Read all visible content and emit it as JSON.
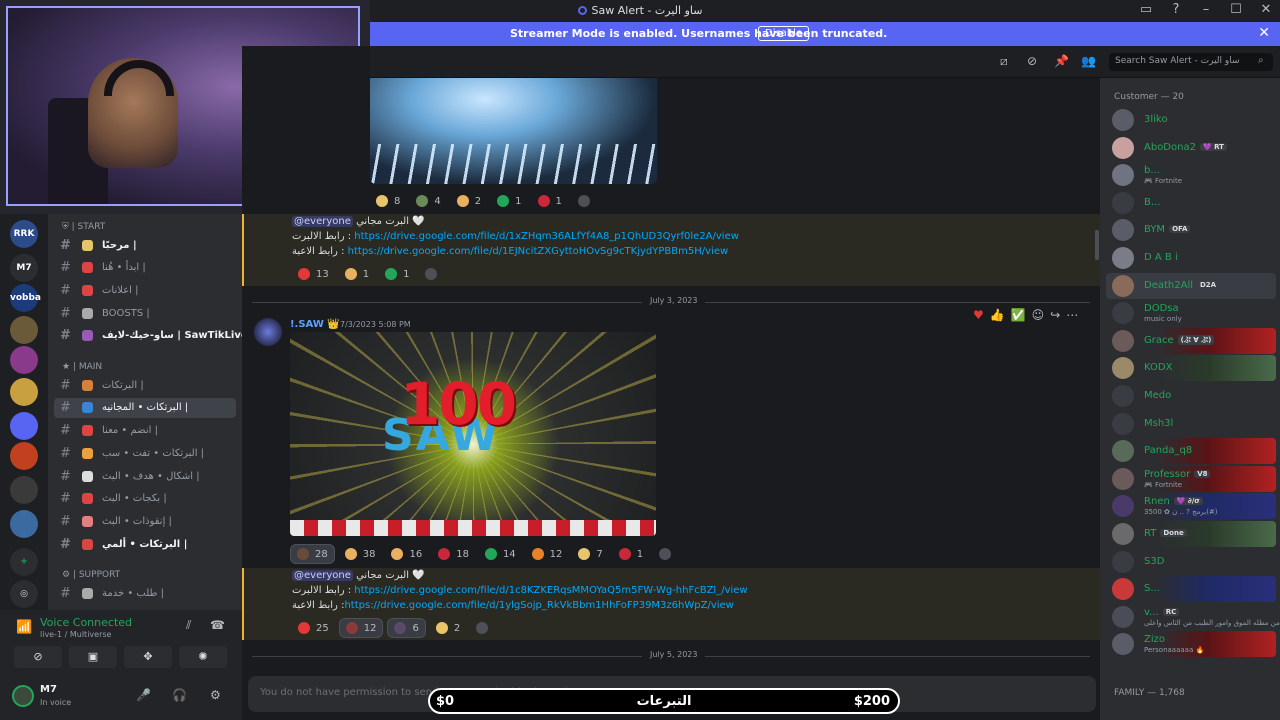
{
  "window": {
    "title": "Saw Alert - ساو اليرت",
    "controls": [
      "▭",
      "?",
      "–",
      "☐",
      "✕"
    ]
  },
  "banner": {
    "text": "Streamer Mode is enabled. Usernames have been truncated.",
    "button": "Disable",
    "close": "✕"
  },
  "servers": [
    {
      "label": "RRK",
      "color": "#2d4a8a"
    },
    {
      "label": "M7\nDN",
      "color": "#2b2d31"
    },
    {
      "label": "vobba",
      "color": "#1c3b7a"
    },
    {
      "label": "",
      "color": "#6a5a3a"
    },
    {
      "label": "",
      "color": "#8a3a8a"
    },
    {
      "label": "",
      "color": "#c8a040"
    },
    {
      "label": "",
      "color": "#5865f2"
    },
    {
      "label": "",
      "color": "#c04020"
    },
    {
      "label": "",
      "color": "#3a3a3a"
    },
    {
      "label": "",
      "color": "#3a6aa0"
    }
  ],
  "channels": {
    "categories": [
      {
        "label": "| START",
        "icon": "⛨"
      },
      {
        "label": "| MAIN",
        "icon": "★"
      },
      {
        "label": "| SUPPORT",
        "icon": "⚙"
      }
    ],
    "items": [
      {
        "label": "مرحبًا |",
        "emoji_color": "#e8c46a",
        "style": "bright"
      },
      {
        "label": "ابدأ • هُنا |",
        "emoji_color": "#d44"
      },
      {
        "label": "اعلانات |",
        "emoji_color": "#d44"
      },
      {
        "label": "BOOSTS |",
        "emoji_color": "#aaa"
      },
      {
        "label": "ساو-خيك-لايف | SawTikLive",
        "emoji_color": "#9b59b6",
        "style": "bright"
      },
      {
        "label": "البرتكات |",
        "emoji_color": "#d4823a"
      },
      {
        "label": "البرتكات • المجانيه |",
        "emoji_color": "#3a86d4",
        "style": "active"
      },
      {
        "label": "انضم • معنا |",
        "emoji_color": "#d44"
      },
      {
        "label": "البرتكات • تفت • سب |",
        "emoji_color": "#e8a040"
      },
      {
        "label": "اشكال • هدف • البث |",
        "emoji_color": "#ddd"
      },
      {
        "label": "بكجات • البث |",
        "emoji_color": "#d44"
      },
      {
        "label": "إنقوذات • البث |",
        "emoji_color": "#e08080"
      },
      {
        "label": "البرتكات • ألمي |",
        "emoji_color": "#d44",
        "style": "bright"
      },
      {
        "label": "طلب • خدمة |",
        "emoji_color": "#aaa"
      }
    ]
  },
  "voice": {
    "status": "Voice Connected",
    "sub": "live-1 / Multiverse",
    "buttons": [
      "⊘",
      "▣",
      "✥",
      "✺"
    ]
  },
  "user": {
    "name": "M7",
    "status": "In voice"
  },
  "chat": {
    "reactions_top": [
      {
        "count": "8",
        "color": "#e8c46a"
      },
      {
        "count": "4",
        "color": "#6a8a5a"
      },
      {
        "count": "2",
        "color": "#e8b060"
      },
      {
        "count": "1",
        "color": "#23a55a"
      },
      {
        "count": "1",
        "color": "#c8283a"
      }
    ],
    "post1": {
      "mention": "@everyone",
      "line1": "البرت مجاني 🤍",
      "line2_label": "رابط الالبرت :",
      "line2_link": "https://drive.google.com/file/d/1xZHqm36ALfYf4A8_p1QhUD3Qyrf0le2A/view",
      "line3_label": "رابط الاعبة :",
      "line3_link": "https://drive.google.com/file/d/1EJNcitZXGyttoHOvSg9cTKjydYPBBm5H/view",
      "reactions": [
        {
          "count": "13",
          "color": "#e23838"
        },
        {
          "count": "1",
          "color": "#e8b060"
        },
        {
          "count": "1",
          "color": "#23a55a"
        }
      ]
    },
    "divider1": "July 3, 2023",
    "post2": {
      "author": "!.SAW 👑",
      "timestamp": "7/3/2023 5:08 PM",
      "image_text_top": "100",
      "image_text_bottom": "SAW",
      "reactions": [
        {
          "count": "28",
          "color": "#6a4a3a",
          "me": true
        },
        {
          "count": "38",
          "color": "#e8b060"
        },
        {
          "count": "16",
          "color": "#e8b060"
        },
        {
          "count": "18",
          "color": "#c8283a"
        },
        {
          "count": "14",
          "color": "#23a55a"
        },
        {
          "count": "12",
          "color": "#e8822a"
        },
        {
          "count": "7",
          "color": "#e8c46a"
        },
        {
          "count": "1",
          "color": "#c8283a"
        }
      ],
      "mention": "@everyone",
      "line1": "البرت مجاني 🤍",
      "line2_label": "رابط الالبرت :",
      "line2_link": "https://drive.google.com/file/d/1c8KZKERqsMMOYaQ5m5FW-Wg-hhFcBZl_/view",
      "line3_label": "رابط الاعبة :",
      "line3_link": "https://drive.google.com/file/d/1ylgSojp_RkVkBbm1HhFoFP39M3z6hWpZ/view",
      "reactions2": [
        {
          "count": "25",
          "color": "#e23838"
        },
        {
          "count": "12",
          "color": "#8a3a3a",
          "me": true
        },
        {
          "count": "6",
          "color": "#5a4a6a",
          "me": true
        },
        {
          "count": "2",
          "color": "#e8c46a"
        }
      ]
    },
    "divider2": "July 5, 2023",
    "input_placeholder": "You do not have permission to send messages in this channel.",
    "hover_toolbar": [
      "♥",
      "👍",
      "✅",
      "☺",
      "↪",
      "⋯"
    ]
  },
  "donation": {
    "left": "$0",
    "center": "التبرعات",
    "right": "$200"
  },
  "header_icons": [
    "⧄",
    "⊘",
    "📌",
    "👥"
  ],
  "search": {
    "placeholder": "Search Saw Alert - ساو اليرت"
  },
  "members": {
    "group1": "Customer — 20",
    "group2": "FAMILY — 1,768",
    "list": [
      {
        "name": "3liko",
        "status": "",
        "tag": ""
      },
      {
        "name": "AboDona2",
        "status": "",
        "tag": "💜 RT"
      },
      {
        "name": "b...",
        "status": "🎮 Fortnite",
        "tag": ""
      },
      {
        "name": "B...",
        "status": "",
        "tag": ""
      },
      {
        "name": "BYM",
        "status": "",
        "tag": "OFA"
      },
      {
        "name": "D A B i",
        "status": "",
        "tag": ""
      },
      {
        "name": "Death2All",
        "status": "",
        "tag": "D2A",
        "style": "sel"
      },
      {
        "name": "DODsa",
        "status": "music only",
        "tag": ""
      },
      {
        "name": "Grace",
        "status": "",
        "tag": "(ぷ ∀ ぷ)",
        "style": "fancy"
      },
      {
        "name": "KODX",
        "status": "",
        "tag": "",
        "style": "fancy3"
      },
      {
        "name": "Medo",
        "status": "",
        "tag": ""
      },
      {
        "name": "Msh3l",
        "status": "",
        "tag": ""
      },
      {
        "name": "Panda_q8",
        "status": "",
        "tag": "",
        "style": "fancy"
      },
      {
        "name": "Professor",
        "status": "🎮 Fortnite",
        "tag": "V8",
        "style": "fancy"
      },
      {
        "name": "Rnen",
        "status": "3500 ✿ برمج ? .. ن(#)",
        "tag": "💜 ∂/σ",
        "style": "fancy2"
      },
      {
        "name": "RT",
        "status": "",
        "tag": "Done",
        "style": "fancy3"
      },
      {
        "name": "S3D",
        "status": "",
        "tag": ""
      },
      {
        "name": "S...",
        "status": "",
        "tag": "",
        "style": "fancy2"
      },
      {
        "name": "v...",
        "status": "من مطله الموق وامور الطيب من الثاس واعلى",
        "tag": "RC"
      },
      {
        "name": "Zizo",
        "status": "Personaaaaaa 🔥",
        "tag": "",
        "style": "fancy"
      }
    ]
  }
}
